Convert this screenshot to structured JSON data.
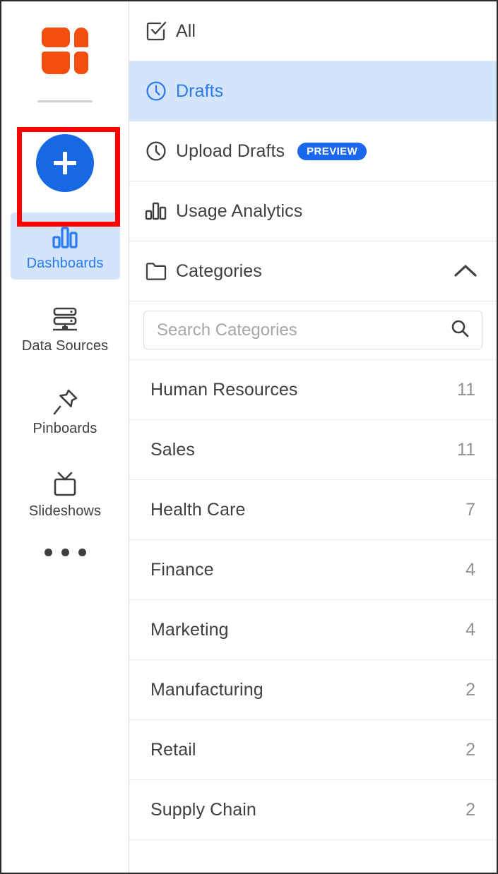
{
  "brand": {
    "logo_icon": "grid-logo-icon",
    "logo_color": "#f44e0f"
  },
  "rail": {
    "create_button": {
      "icon": "plus-icon",
      "label": "",
      "color": "#1668e3",
      "highlight_color": "#ff0000"
    },
    "items": [
      {
        "label": "Dashboards",
        "icon": "bar-chart-icon",
        "active": true
      },
      {
        "label": "Data Sources",
        "icon": "database-icon",
        "active": false
      },
      {
        "label": "Pinboards",
        "icon": "pushpin-icon",
        "active": false
      },
      {
        "label": "Slideshows",
        "icon": "tv-icon",
        "active": false
      }
    ],
    "more": {
      "label": "",
      "icon": "more-horizontal-icon"
    }
  },
  "panel": {
    "menu": [
      {
        "label": "All",
        "icon": "checkbox-checked-icon",
        "selected": false,
        "badge": null
      },
      {
        "label": "Drafts",
        "icon": "clock-icon",
        "selected": true,
        "badge": null
      },
      {
        "label": "Upload Drafts",
        "icon": "clock-icon",
        "selected": false,
        "badge": "PREVIEW"
      },
      {
        "label": "Usage Analytics",
        "icon": "bar-chart-icon",
        "selected": false,
        "badge": null
      }
    ],
    "categories_header": {
      "label": "Categories",
      "icon": "folder-icon",
      "collapse_icon": "chevron-up-icon",
      "expanded": true
    },
    "search": {
      "placeholder": "Search Categories",
      "value": "",
      "icon": "search-icon"
    },
    "categories": [
      {
        "name": "Human Resources",
        "count": "11"
      },
      {
        "name": "Sales",
        "count": "11"
      },
      {
        "name": "Health Care",
        "count": "7"
      },
      {
        "name": "Finance",
        "count": "4"
      },
      {
        "name": "Marketing",
        "count": "4"
      },
      {
        "name": "Manufacturing",
        "count": "2"
      },
      {
        "name": "Retail",
        "count": "2"
      },
      {
        "name": "Supply Chain",
        "count": "2"
      }
    ]
  },
  "colors": {
    "accent_blue": "#2b7cf0",
    "selected_bg": "#d4e4fb",
    "badge_blue": "#1a67f0",
    "text": "#3c4043",
    "muted": "#8e9296"
  }
}
